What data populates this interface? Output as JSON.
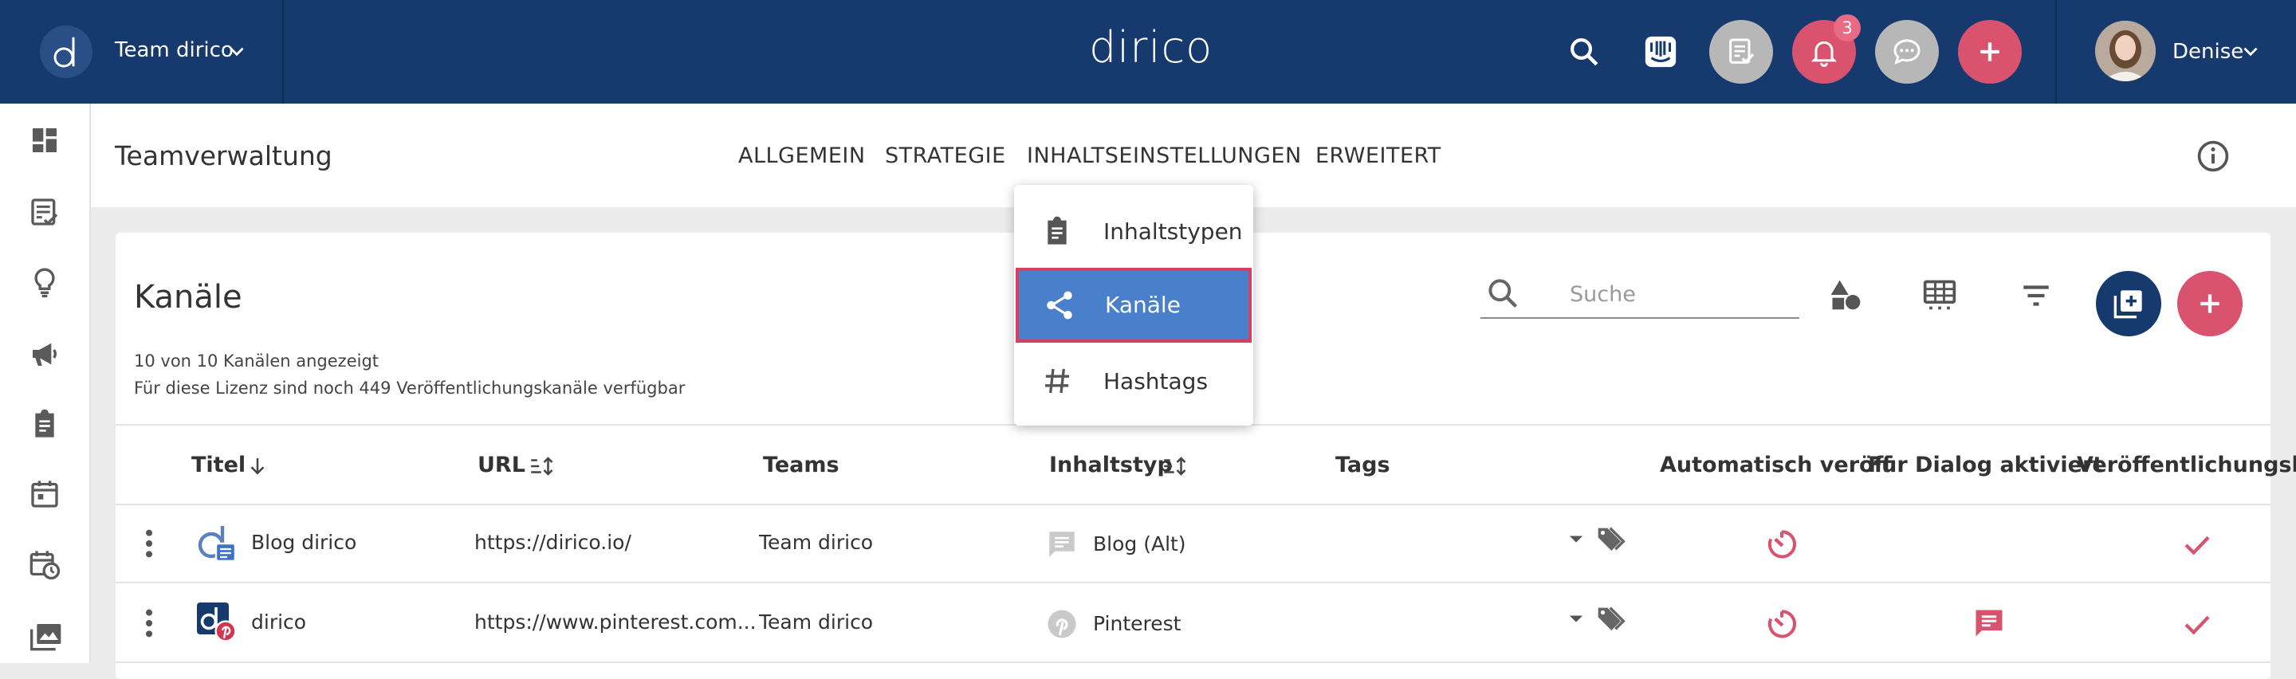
{
  "topbar": {
    "team_name": "Team dirico",
    "brand": "dirico",
    "notification_count": "3",
    "user_name": "Denise"
  },
  "subheader": {
    "page_title": "Teamverwaltung",
    "tabs": [
      {
        "label": "ALLGEMEIN"
      },
      {
        "label": "STRATEGIE"
      },
      {
        "label": "INHALTSEINSTELLUNGEN"
      },
      {
        "label": "ERWEITERT"
      }
    ]
  },
  "dropdown": {
    "items": [
      {
        "label": "Inhaltstypen",
        "icon": "clipboard-icon"
      },
      {
        "label": "Kanäle",
        "icon": "share-icon",
        "selected": true
      },
      {
        "label": "Hashtags",
        "icon": "hashtag-icon"
      }
    ]
  },
  "card": {
    "title": "Kanäle",
    "info_line1": "10 von 10 Kanälen angezeigt",
    "info_line2": "Für diese Lizenz sind noch 449 Veröffentlichungskanäle verfügbar",
    "search_placeholder": "Suche"
  },
  "table": {
    "columns": [
      {
        "label": "Titel"
      },
      {
        "label": "URL"
      },
      {
        "label": "Teams"
      },
      {
        "label": "Inhaltstyp"
      },
      {
        "label": "Tags"
      },
      {
        "label": "Automatisch veröff"
      },
      {
        "label": "Für Dialog aktiviert"
      },
      {
        "label": "Veröffentlichungsk"
      }
    ],
    "rows": [
      {
        "title": "Blog dirico",
        "url": "https://dirico.io/",
        "team": "Team dirico",
        "content_type": "Blog (Alt)"
      },
      {
        "title": "dirico",
        "url": "https://www.pinterest.com...",
        "team": "Team dirico",
        "content_type": "Pinterest"
      }
    ]
  },
  "colors": {
    "topbar": "#163a6e",
    "accent": "#d9536e",
    "selected": "#4a7fcb",
    "fab_blue": "#163a6e"
  }
}
